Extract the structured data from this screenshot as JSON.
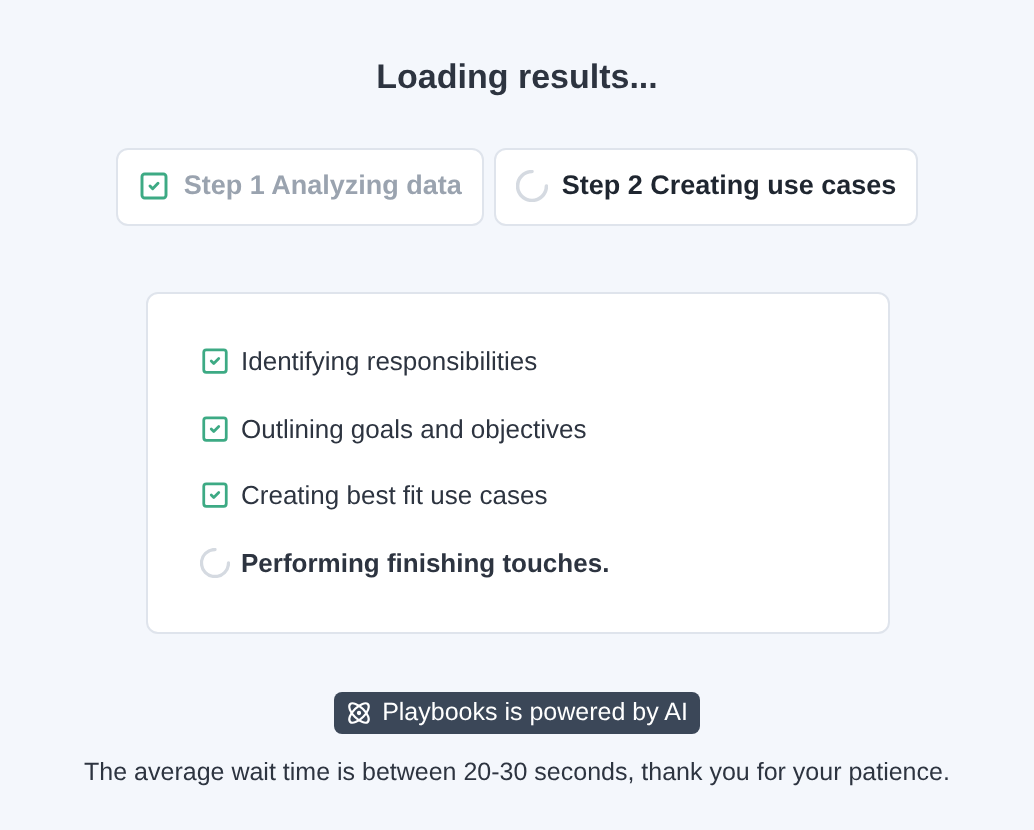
{
  "title": "Loading results...",
  "steps": [
    {
      "label": "Step 1 Analyzing data",
      "kind": "done"
    },
    {
      "label": "Step 2 Creating use cases",
      "kind": "loading"
    }
  ],
  "tasks": [
    {
      "label": "Identifying responsibilities",
      "kind": "done"
    },
    {
      "label": "Outlining goals and objectives",
      "kind": "done"
    },
    {
      "label": "Creating best fit use cases",
      "kind": "done"
    },
    {
      "label": "Performing finishing touches.",
      "kind": "loading"
    }
  ],
  "badge": "Playbooks is powered by AI",
  "footer": "The average wait time is between 20-30 seconds, thank you for your patience."
}
